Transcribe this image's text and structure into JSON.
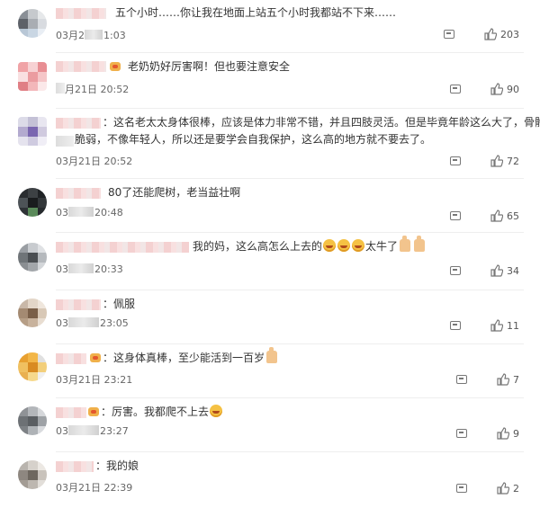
{
  "comments": [
    {
      "text": "五个小时……你让我在地面上站五个小时我都站不下来……",
      "time": "03月2:1:03",
      "time_prefix": "03月2",
      "time_suffix": "1:03",
      "likes": "203"
    },
    {
      "text": "老奶奶好厉害啊！但也要注意安全",
      "time": "月21日 20:52",
      "likes": "90"
    },
    {
      "text_line1": "：这名老太太身体很棒，应该是体力非常不错，并且四肢灵活。但是毕竟年龄这么大了，骨骼",
      "text_line2": "脆弱，不像年轻人，所以还是要学会自我保护，这么高的地方就不要去了。",
      "time": "03月21日 20:52",
      "likes": "72"
    },
    {
      "text": "80了还能爬树，老当益壮啊",
      "time_prefix": "03",
      "time_suffix": "20:48",
      "likes": "65"
    },
    {
      "text": "我的妈，这么高怎么上去的",
      "text_tail": "太牛了",
      "time_prefix": "03",
      "time_suffix": "20:33",
      "likes": "34"
    },
    {
      "text": "：佩服",
      "time_prefix": "03",
      "time_suffix": "23:05",
      "likes": "11"
    },
    {
      "text": "：这身体真棒，至少能活到一百岁",
      "time_prefix": "03月21日",
      "time": "03月21日 23:21",
      "likes": "7"
    },
    {
      "text": "：厉害。我都爬不上去",
      "time_prefix": "03",
      "time_suffix": "23:27",
      "likes": "9"
    },
    {
      "text": "：我的娘",
      "time": "03月21日 22:39",
      "likes": "2"
    }
  ],
  "icons": {
    "reply": "comment-icon",
    "like": "thumbs-up-icon"
  },
  "colors": {
    "text": "#333333",
    "meta": "#666666",
    "divider": "#eeeeee"
  }
}
